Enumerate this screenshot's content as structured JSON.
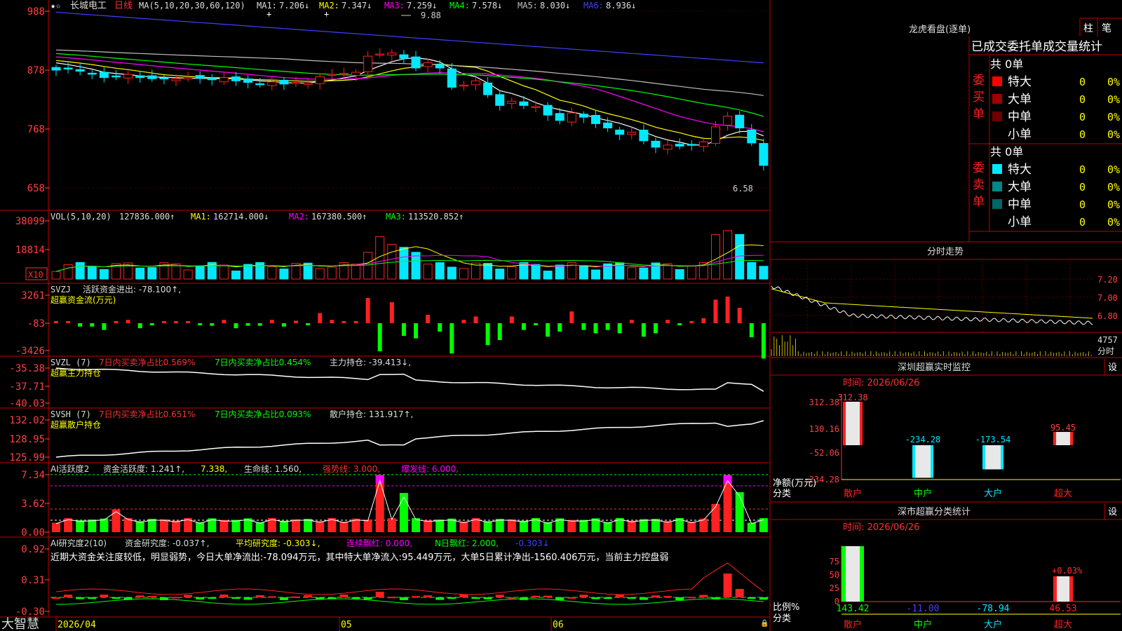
{
  "app": {
    "name": "大智慧"
  },
  "colors": {
    "up": "#ff2020",
    "down": "#00e8ff",
    "ma1": "#ffffff",
    "ma2": "#ffff00",
    "ma3": "#ff00ff",
    "ma4": "#00ff00",
    "ma5": "#c0c0c0",
    "ma6": "#4040ff",
    "grid": "#c00000",
    "axis": "#ff4040",
    "green": "#00ff00"
  },
  "main": {
    "title": "长城电工",
    "period": "日线",
    "ma_label": "MA(5,10,20,30,60,120)",
    "ma_items": [
      {
        "label": "MA1:",
        "value": "7.206↓"
      },
      {
        "label": "MA2:",
        "value": "7.347↓"
      },
      {
        "label": "MA3:",
        "value": "7.259↓"
      },
      {
        "label": "MA4:",
        "value": "7.578↓"
      },
      {
        "label": "MA5:",
        "value": "8.030↓"
      },
      {
        "label": "MA6:",
        "value": "8.936↓"
      }
    ],
    "yticks": [
      "988",
      "878",
      "768",
      "658"
    ],
    "high_note": "9.88",
    "low_note": "6.58"
  },
  "vol": {
    "label": "VOL(5,10,20)",
    "value": "127836.000↑",
    "items": [
      {
        "label": "MA1:",
        "value": "162714.000↓"
      },
      {
        "label": "MA2:",
        "value": "167380.500↑"
      },
      {
        "label": "MA3:",
        "value": "113520.852↑"
      }
    ],
    "yticks": [
      "38099",
      "18814"
    ],
    "unit": "X10"
  },
  "svzj": {
    "label": "SVZJ",
    "text": "活跃资金进出: -78.100↑,",
    "sub": "超赢资金流(万元)",
    "yticks": [
      "3261",
      "-83",
      "-3426"
    ]
  },
  "svzl": {
    "label": "SVZL (7)",
    "t1": "7日内买卖净占比0.569%",
    "t2": "7日内买卖净占比0.454%",
    "t3": "主力持仓: -39.413↓,",
    "sub": "超赢主力持仓",
    "yticks": [
      "-35.38",
      "-37.71",
      "-40.03"
    ]
  },
  "svsh": {
    "label": "SVSH (7)",
    "t1": "7日内买卖净占比0.651%",
    "t2": "7日内买卖净占比0.093%",
    "t3": "散户持仓: 131.917↑,",
    "sub": "超赢散户持仓",
    "yticks": [
      "132.02",
      "128.95",
      "125.99"
    ]
  },
  "ai1": {
    "label": "AI活跃度2",
    "t1": "资金活跃度: 1.241↑,",
    "t2": "7.338,",
    "t3": "生命线: 1.560,",
    "t4": "强势线: 3.000,",
    "t5": "爆发线: 6.000,",
    "yticks": [
      "7.34",
      "3.62",
      "0.00"
    ]
  },
  "ai2": {
    "label": "AI研究度2(10)",
    "t1": "资金研究度: -0.037↑,",
    "t2": "平均研究度: -0.303↓,",
    "t3": "连续飘红: 0.000,",
    "t4": "N日飘红: 2.000,",
    "t5": "-0.303↓",
    "comment": "近期大资金关注度较低，明显弱势，今日大单净流出:-78.094万元，其中特大单净流入:95.449万元，大单5日累计净出-1560.406万元，当前主力控盘弱",
    "yticks": [
      "0.92",
      "0.31",
      "-0.30"
    ]
  },
  "xaxis": {
    "labels": [
      "2026/04",
      "05",
      "06"
    ]
  },
  "dragon": {
    "title": "龙虎看盘(逐单)",
    "btn1": "柱",
    "btn2": "笔",
    "header": "已成交委托单成交量统计",
    "buy": {
      "side": "委买单",
      "total": "共 0单",
      "rows": [
        {
          "name": "特大",
          "count": "0",
          "pct": "0%",
          "color": "#ff0000"
        },
        {
          "name": "大单",
          "count": "0",
          "pct": "0%",
          "color": "#a00000"
        },
        {
          "name": "中单",
          "count": "0",
          "pct": "0%",
          "color": "#700000"
        },
        {
          "name": "小单",
          "count": "0",
          "pct": "0%",
          "color": ""
        }
      ]
    },
    "sell": {
      "side": "委卖单",
      "total": "共 0单",
      "rows": [
        {
          "name": "特大",
          "count": "0",
          "pct": "0%",
          "color": "#00e8ff"
        },
        {
          "name": "大单",
          "count": "0",
          "pct": "0%",
          "color": "#008888"
        },
        {
          "name": "中单",
          "count": "0",
          "pct": "0%",
          "color": "#006666"
        },
        {
          "name": "小单",
          "count": "0",
          "pct": "0%",
          "color": ""
        }
      ]
    }
  },
  "intraday": {
    "title": "分时走势",
    "yticks": [
      "7.20",
      "7.00",
      "6.80"
    ],
    "vol_top": "4757",
    "vol_label": "分时"
  },
  "monitor": {
    "title": "深圳超赢实时监控",
    "btn": "设",
    "time": "时间: 2026/06/26",
    "yticks": [
      "312.38",
      "130.16",
      "-52.06",
      "-234.28"
    ],
    "net_label": "净额(万元)",
    "cat_label": "分类",
    "bars": [
      {
        "name": "散户",
        "value": 312.38,
        "label": "312.38"
      },
      {
        "name": "中户",
        "value": -234.28,
        "label": "-234.28"
      },
      {
        "name": "大户",
        "value": -173.54,
        "label": "-173.54"
      },
      {
        "name": "超大",
        "value": 95.45,
        "label": "95.45"
      }
    ]
  },
  "classify": {
    "title": "深市超赢分类统计",
    "btn": "设",
    "time": "时间: 2026/06/26",
    "yticks": [
      "75",
      "50",
      "25",
      "0"
    ],
    "ratio_label": "比例%",
    "cat_label": "分类",
    "top_note": "+0.03%",
    "bars": [
      {
        "name": "散户",
        "value": "143.42"
      },
      {
        "name": "中户",
        "value": "-11.00"
      },
      {
        "name": "大户",
        "value": "-78.94"
      },
      {
        "name": "超大",
        "value": "46.53"
      }
    ]
  }
}
